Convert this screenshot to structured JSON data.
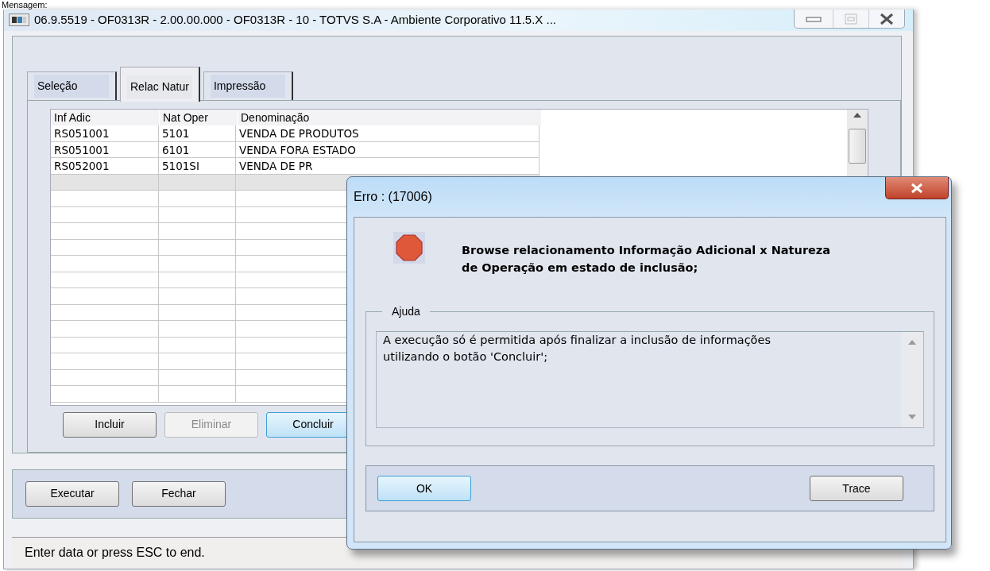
{
  "caption": "Mensagem:",
  "window": {
    "title": "06.9.5519 - OF0313R - 2.00.00.000 - OF0313R - 10 - TOTVS S.A - Ambiente Corporativo 11.5.X ..."
  },
  "tabs": [
    {
      "label": "Seleção",
      "selected": false
    },
    {
      "label": "Relac Natur",
      "selected": true
    },
    {
      "label": "Impressão",
      "selected": false
    }
  ],
  "table": {
    "columns": [
      "Inf Adic",
      "Nat Oper",
      "Denominação"
    ],
    "rows": [
      {
        "cells": [
          "RS051001",
          "5101",
          "VENDA DE PRODUTOS"
        ],
        "selected": false
      },
      {
        "cells": [
          "RS051001",
          "6101",
          "VENDA FORA ESTADO"
        ],
        "selected": false
      },
      {
        "cells": [
          "RS052001",
          "5101SI",
          "VENDA DE PR"
        ],
        "selected": false
      },
      {
        "selected": true
      }
    ]
  },
  "grid_buttons": [
    {
      "label": "Incluir",
      "disabled": false,
      "focused": false
    },
    {
      "label": "Eliminar",
      "disabled": true,
      "focused": false
    },
    {
      "label": "Concluir",
      "disabled": false,
      "focused": true
    }
  ],
  "footer_buttons": [
    {
      "label": "Executar",
      "focused": false
    },
    {
      "label": "Fechar",
      "focused": false
    }
  ],
  "status_bar": "Enter data or press ESC to end.",
  "dialog": {
    "title": "Erro : (17006)",
    "message": "Browse relacionamento Informação Adicional x Natureza de Operação em estado de inclusão;",
    "help_label": "Ajuda",
    "help_text": "A execução só é permitida após finalizar a inclusão de informações utilizando o botão 'Concluir';",
    "buttons": [
      {
        "label": "OK",
        "focused": true
      },
      {
        "label": "Trace",
        "focused": false
      }
    ]
  }
}
